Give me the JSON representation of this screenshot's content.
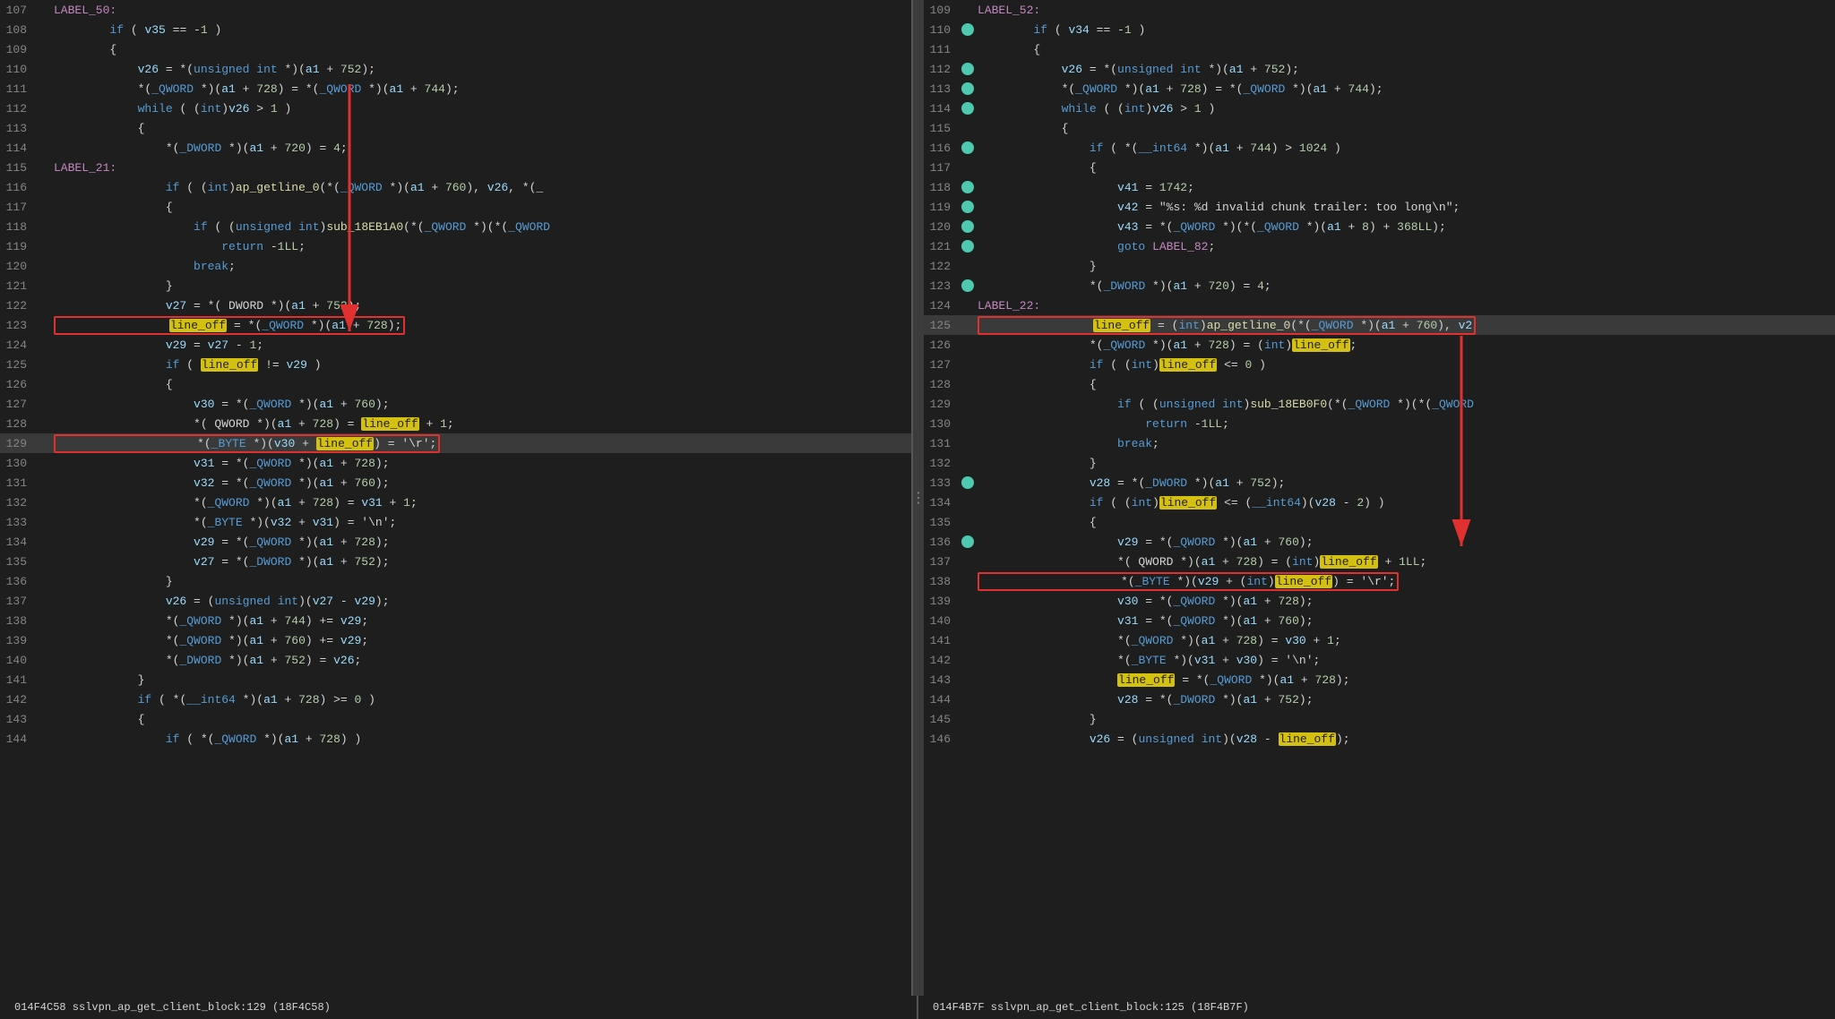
{
  "left_pane": {
    "lines": [
      {
        "num": "107",
        "text": "LABEL_50:",
        "type": "label"
      },
      {
        "num": "108",
        "text": "        if ( v35 == -1 )",
        "type": "code"
      },
      {
        "num": "109",
        "text": "        {",
        "type": "code"
      },
      {
        "num": "110",
        "text": "            v26 = *(unsigned int *)(a1 + 752);",
        "type": "code"
      },
      {
        "num": "111",
        "text": "            *(_QWORD *)(a1 + 728) = *(_QWORD *)(a1 + 744);",
        "type": "code",
        "box": true
      },
      {
        "num": "112",
        "text": "            while ( (int)v26 > 1 )",
        "type": "code"
      },
      {
        "num": "113",
        "text": "            {",
        "type": "code"
      },
      {
        "num": "114",
        "text": "                *(_DWORD *)(a1 + 720) = 4;",
        "type": "code"
      },
      {
        "num": "115",
        "text": "LABEL_21:",
        "type": "label"
      },
      {
        "num": "116",
        "text": "                if ( (int)ap_getline_0(*(_QWORD *)(a1 + 760), v26, *(_",
        "type": "code"
      },
      {
        "num": "117",
        "text": "                {",
        "type": "code"
      },
      {
        "num": "118",
        "text": "                    if ( (unsigned int)sub_18EB1A0(*(_QWORD *)(*(_QWORD",
        "type": "code"
      },
      {
        "num": "119",
        "text": "                        return -1LL;",
        "type": "code"
      },
      {
        "num": "120",
        "text": "                    break;",
        "type": "code"
      },
      {
        "num": "121",
        "text": "                }",
        "type": "code"
      },
      {
        "num": "122",
        "text": "                v27 = *( DWORD *)(a1 + 752);",
        "type": "code"
      },
      {
        "num": "123",
        "text": "                line_off = *(_QWORD *)(a1 + 728);",
        "type": "code",
        "box": true,
        "highlight_word": "line_off"
      },
      {
        "num": "124",
        "text": "                v29 = v27 - 1;",
        "type": "code"
      },
      {
        "num": "125",
        "text": "                if ( line_off != v29 )",
        "type": "code",
        "highlight_word": "line_off"
      },
      {
        "num": "126",
        "text": "                {",
        "type": "code"
      },
      {
        "num": "127",
        "text": "                    v30 = *(_QWORD *)(a1 + 760);",
        "type": "code"
      },
      {
        "num": "128",
        "text": "                    *( QWORD *)(a1 + 728) = line_off + 1;",
        "type": "code",
        "highlight_word": "line_off"
      },
      {
        "num": "129",
        "text": "                    *(_BYTE *)(v30 + line_off) = '\\r';",
        "type": "code",
        "box": true,
        "highlight_word": "line_off",
        "highlighted": true
      },
      {
        "num": "130",
        "text": "                    v31 = *(_QWORD *)(a1 + 728);",
        "type": "code"
      },
      {
        "num": "131",
        "text": "                    v32 = *(_QWORD *)(a1 + 760);",
        "type": "code"
      },
      {
        "num": "132",
        "text": "                    *(_QWORD *)(a1 + 728) = v31 + 1;",
        "type": "code"
      },
      {
        "num": "133",
        "text": "                    *(_BYTE *)(v32 + v31) = '\\n';",
        "type": "code"
      },
      {
        "num": "134",
        "text": "                    v29 = *(_QWORD *)(a1 + 728);",
        "type": "code"
      },
      {
        "num": "135",
        "text": "                    v27 = *(_DWORD *)(a1 + 752);",
        "type": "code"
      },
      {
        "num": "136",
        "text": "                }",
        "type": "code"
      },
      {
        "num": "137",
        "text": "                v26 = (unsigned int)(v27 - v29);",
        "type": "code"
      },
      {
        "num": "138",
        "text": "                *(_QWORD *)(a1 + 744) += v29;",
        "type": "code"
      },
      {
        "num": "139",
        "text": "                *(_QWORD *)(a1 + 760) += v29;",
        "type": "code"
      },
      {
        "num": "140",
        "text": "                *(_DWORD *)(a1 + 752) = v26;",
        "type": "code"
      },
      {
        "num": "141",
        "text": "            }",
        "type": "code"
      },
      {
        "num": "142",
        "text": "            if ( *(__int64 *)(a1 + 728) >= 0 )",
        "type": "code"
      },
      {
        "num": "143",
        "text": "            {",
        "type": "code"
      },
      {
        "num": "144",
        "text": "                if ( *(_QWORD *)(a1 + 728) )",
        "type": "code"
      }
    ],
    "status": "014F4C58 sslvpn_ap_get_client_block:129 (18F4C58)"
  },
  "right_pane": {
    "lines": [
      {
        "num": "109",
        "text": "LABEL_52:",
        "type": "label"
      },
      {
        "num": "110",
        "text": "        if ( v34 == -1 )",
        "type": "code",
        "dot": true
      },
      {
        "num": "111",
        "text": "        {",
        "type": "code"
      },
      {
        "num": "112",
        "text": "            v26 = *(unsigned int *)(a1 + 752);",
        "type": "code",
        "dot": true
      },
      {
        "num": "113",
        "text": "            *(_QWORD *)(a1 + 728) = *(_QWORD *)(a1 + 744);",
        "type": "code",
        "dot": true
      },
      {
        "num": "114",
        "text": "            while ( (int)v26 > 1 )",
        "type": "code",
        "dot": true
      },
      {
        "num": "115",
        "text": "            {",
        "type": "code"
      },
      {
        "num": "116",
        "text": "                if ( *(__int64 *)(a1 + 744) > 1024 )",
        "type": "code",
        "dot": true
      },
      {
        "num": "117",
        "text": "                {",
        "type": "code"
      },
      {
        "num": "118",
        "text": "                    v41 = 1742;",
        "type": "code",
        "dot": true
      },
      {
        "num": "119",
        "text": "                    v42 = \"%s: %d invalid chunk trailer: too long\\n\";",
        "type": "code",
        "dot": true
      },
      {
        "num": "120",
        "text": "                    v43 = *(_QWORD *)(*(_QWORD *)(a1 + 8) + 368LL);",
        "type": "code",
        "dot": true
      },
      {
        "num": "121",
        "text": "                    goto LABEL_82;",
        "type": "code",
        "dot": true
      },
      {
        "num": "122",
        "text": "                }",
        "type": "code"
      },
      {
        "num": "123",
        "text": "                *(_DWORD *)(a1 + 720) = 4;",
        "type": "code",
        "dot": true
      },
      {
        "num": "124",
        "text": "LABEL_22:",
        "type": "label"
      },
      {
        "num": "125",
        "text": "                line_off = (int)ap_getline_0(*(_QWORD *)(a1 + 760), v2",
        "type": "code",
        "box": true,
        "highlight_word": "line_off",
        "highlighted": true
      },
      {
        "num": "126",
        "text": "                *(_QWORD *)(a1 + 728) = (int)line_off;",
        "type": "code",
        "highlight_word": "line_off"
      },
      {
        "num": "127",
        "text": "                if ( (int)line_off <= 0 )",
        "type": "code",
        "highlight_word": "line_off"
      },
      {
        "num": "128",
        "text": "                {",
        "type": "code"
      },
      {
        "num": "129",
        "text": "                    if ( (unsigned int)sub_18EB0F0(*(_QWORD *)(*(_QWORD",
        "type": "code"
      },
      {
        "num": "130",
        "text": "                        return -1LL;",
        "type": "code"
      },
      {
        "num": "131",
        "text": "                    break;",
        "type": "code"
      },
      {
        "num": "132",
        "text": "                }",
        "type": "code"
      },
      {
        "num": "133",
        "text": "                v28 = *(_DWORD *)(a1 + 752);",
        "type": "code",
        "dot": true
      },
      {
        "num": "134",
        "text": "                if ( (int)line_off <= (__int64)(v28 - 2) )",
        "type": "code",
        "highlight_word": "line_off"
      },
      {
        "num": "135",
        "text": "                {",
        "type": "code"
      },
      {
        "num": "136",
        "text": "                    v29 = *(_QWORD *)(a1 + 760);",
        "type": "code",
        "dot": true
      },
      {
        "num": "137",
        "text": "                    *( QWORD *)(a1 + 728) = (int)line_off + 1LL;",
        "type": "code",
        "highlight_word": "line_off"
      },
      {
        "num": "138",
        "text": "                    *(_BYTE *)(v29 + (int)line_off) = '\\r';",
        "type": "code",
        "box": true,
        "highlight_word": "line_off"
      },
      {
        "num": "139",
        "text": "                    v30 = *(_QWORD *)(a1 + 728);",
        "type": "code"
      },
      {
        "num": "140",
        "text": "                    v31 = *(_QWORD *)(a1 + 760);",
        "type": "code"
      },
      {
        "num": "141",
        "text": "                    *(_QWORD *)(a1 + 728) = v30 + 1;",
        "type": "code"
      },
      {
        "num": "142",
        "text": "                    *(_BYTE *)(v31 + v30) = '\\n';",
        "type": "code"
      },
      {
        "num": "143",
        "text": "                    line_off = *(_QWORD *)(a1 + 728);",
        "type": "code",
        "highlight_word": "line_off",
        "highlight_box_word": true
      },
      {
        "num": "144",
        "text": "                    v28 = *(_DWORD *)(a1 + 752);",
        "type": "code"
      },
      {
        "num": "145",
        "text": "                }",
        "type": "code"
      },
      {
        "num": "146",
        "text": "                v26 = (unsigned int)(v28 - line_off);",
        "type": "code",
        "highlight_word": "line_off"
      }
    ],
    "status": "014F4B7F sslvpn_ap_get_client_block:125 (18F4B7F)"
  }
}
